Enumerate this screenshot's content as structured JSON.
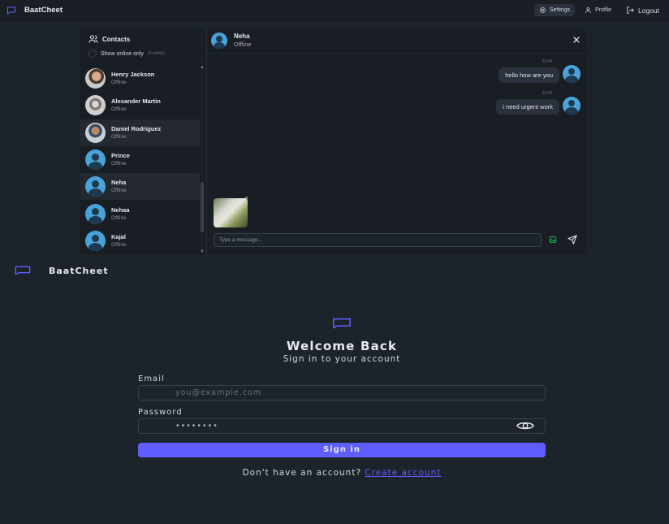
{
  "app": {
    "name": "BaatCheet"
  },
  "topbar": {
    "settings_label": "Settings",
    "profile_label": "Profile",
    "logout_label": "Logout"
  },
  "sidebar": {
    "title": "Contacts",
    "online_only_label": "Show online only",
    "online_count": "(0 online)",
    "contacts": [
      {
        "name": "Henry Jackson",
        "status": "Offline",
        "avatar": "photo1",
        "active": false
      },
      {
        "name": "Alexander Martin",
        "status": "Offline",
        "avatar": "photo2",
        "active": false
      },
      {
        "name": "Daniel Rodriguez",
        "status": "Offline",
        "avatar": "photo3",
        "active": true
      },
      {
        "name": "Prince",
        "status": "Offline",
        "avatar": "default",
        "active": false
      },
      {
        "name": "Neha",
        "status": "Offline",
        "avatar": "default",
        "active": true
      },
      {
        "name": "Nehaa",
        "status": "Offline",
        "avatar": "default",
        "active": false
      },
      {
        "name": "Kajal",
        "status": "Offline",
        "avatar": "default",
        "active": false
      }
    ]
  },
  "chat": {
    "contact_name": "Neha",
    "contact_status": "Offline",
    "messages": [
      {
        "time": "23:49",
        "text": "hello how are you"
      },
      {
        "time": "23:49",
        "text": "i need urgent work"
      }
    ],
    "input_placeholder": "Type a message..."
  },
  "login": {
    "brand": "BaatCheet",
    "title": "Welcome Back",
    "subtitle": "Sign in to your account",
    "email_label": "Email",
    "email_placeholder": "you@example.com",
    "password_label": "Password",
    "password_value": "••••••••",
    "signin_label": "Sign in",
    "no_account_text": "Don't have an account?",
    "create_account_label": "Create account"
  },
  "colors": {
    "accent": "#605dff",
    "avatar_default": "#4aa3d8",
    "bg": "#1d232a"
  }
}
